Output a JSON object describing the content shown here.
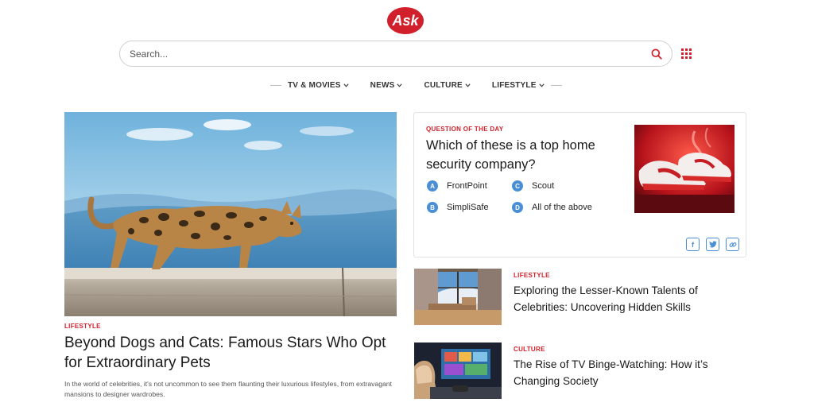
{
  "header": {
    "logo_text": "Ask",
    "search": {
      "placeholder": "Search..."
    },
    "brand_color": "#d1202b"
  },
  "nav": {
    "items": [
      {
        "label": "TV & MOVIES"
      },
      {
        "label": "NEWS"
      },
      {
        "label": "CULTURE"
      },
      {
        "label": "LIFESTYLE"
      }
    ]
  },
  "feature": {
    "image": "bengal-cat-walking-on-ledge",
    "kicker": "LIFESTYLE",
    "title": "Beyond Dogs and Cats: Famous Stars Who Opt for Extraordinary Pets",
    "description": "In the world of celebrities, it's not uncommon to see them flaunting their luxurious lifestyles, from extravagant mansions to designer wardrobes."
  },
  "question": {
    "kicker": "QUESTION OF THE DAY",
    "text": "Which of these is a top home security company?",
    "options": [
      {
        "letter": "A",
        "label": "FrontPoint"
      },
      {
        "letter": "C",
        "label": "Scout"
      },
      {
        "letter": "B",
        "label": "SimpliSafe"
      },
      {
        "letter": "D",
        "label": "All of the above"
      }
    ],
    "image": "sneakers-red-light",
    "badge_color": "#4a8fd6",
    "share": {
      "facebook": "f",
      "twitter": "t",
      "link": "link"
    }
  },
  "articles": [
    {
      "kicker": "LIFESTYLE",
      "title": "Exploring the Lesser-Known Talents of Celebrities: Uncovering Hidden Skills",
      "image": "living-room-window"
    },
    {
      "kicker": "CULTURE",
      "title": "The Rise of TV Binge-Watching: How it’s Changing Society",
      "image": "person-watching-tv"
    }
  ]
}
